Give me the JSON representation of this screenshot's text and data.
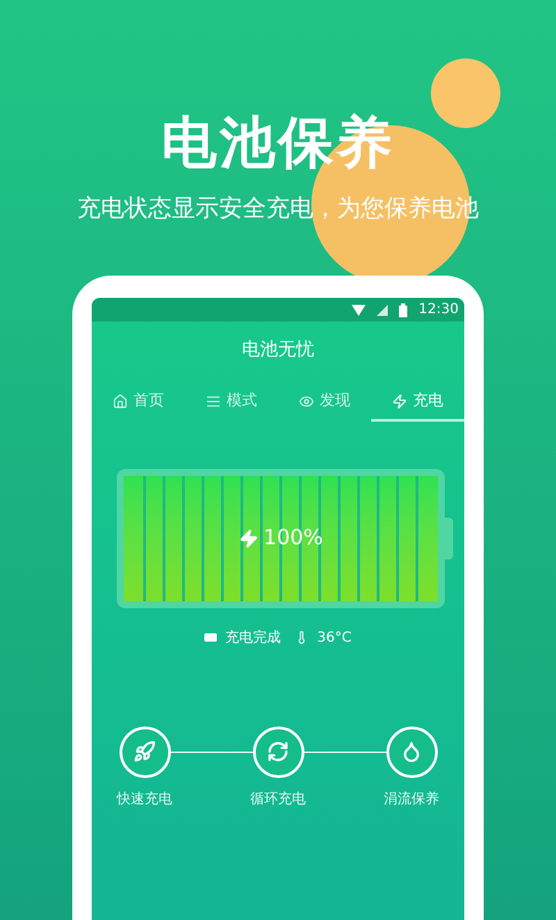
{
  "headline": "电池保养",
  "subtitle": "充电状态显示安全充电，为您保养电池",
  "status_bar": {
    "time": "12:30"
  },
  "app_title": "电池无忧",
  "tabs": [
    {
      "label": "首页",
      "selected": false
    },
    {
      "label": "模式",
      "selected": false
    },
    {
      "label": "发现",
      "selected": false
    },
    {
      "label": "充电",
      "selected": true
    }
  ],
  "battery": {
    "level": 1,
    "percent": "100%",
    "status": "充电完成",
    "temperature": "36°C"
  },
  "modes": [
    {
      "label": "快速充电"
    },
    {
      "label": "循环充电"
    },
    {
      "label": "涓流保养"
    }
  ]
}
